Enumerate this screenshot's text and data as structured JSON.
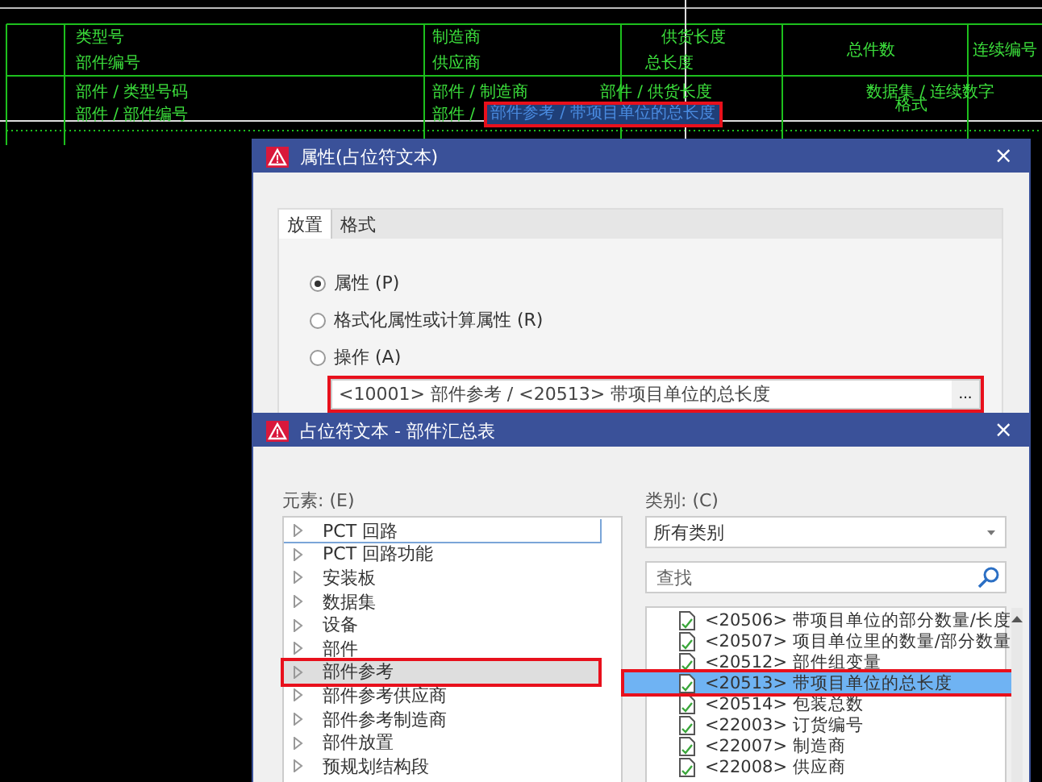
{
  "drawing": {
    "header": [
      {
        "text": "类型号"
      },
      {
        "text": "部件编号"
      },
      {
        "text": "制造商"
      },
      {
        "text": "供应商"
      },
      {
        "text": "供货长度"
      },
      {
        "text": "总长度"
      },
      {
        "text": "总件数"
      },
      {
        "text": "连续编号"
      }
    ],
    "fields": [
      {
        "text": "部件 / 类型号码",
        "selected": false
      },
      {
        "text": "部件 / 部件编号",
        "selected": false
      },
      {
        "text": "部件 / 制造商",
        "selected": false
      },
      {
        "text": "部件 /",
        "selected": false
      },
      {
        "text": "部件 / 供货长度",
        "selected": false
      },
      {
        "text": "部件参考 / 带项目单位的总长度",
        "selected": true
      },
      {
        "text": "数据集 / 连续数字",
        "selected": false
      },
      {
        "text": "格式",
        "selected": false
      }
    ]
  },
  "properties_dialog": {
    "title": "属性(占位符文本)",
    "close": "×",
    "tabs": [
      {
        "label": "放置",
        "selected": true
      },
      {
        "label": "格式",
        "selected": false
      }
    ],
    "options": [
      {
        "label": "属性 (P)",
        "selected": true
      },
      {
        "label": "格式化属性或计算属性 (R)",
        "selected": false
      },
      {
        "label": "操作 (A)",
        "selected": false
      }
    ],
    "value": "<10001> 部件参考 / <20513> 带项目单位的总长度",
    "value_annotated": true,
    "browse": "..."
  },
  "placeholder_dialog": {
    "title": "占位符文本 - 部件汇总表",
    "close": "×",
    "elements_label": "元素: (E)",
    "elements": [
      {
        "label": "PCT 回路",
        "selected": false,
        "focused": true,
        "annotated": false
      },
      {
        "label": "PCT 回路功能",
        "selected": false,
        "focused": false,
        "annotated": false
      },
      {
        "label": "安装板",
        "selected": false,
        "focused": false,
        "annotated": false
      },
      {
        "label": "数据集",
        "selected": false,
        "focused": false,
        "annotated": false
      },
      {
        "label": "设备",
        "selected": false,
        "focused": false,
        "annotated": false
      },
      {
        "label": "部件",
        "selected": false,
        "focused": false,
        "annotated": false
      },
      {
        "label": "部件参考",
        "selected": true,
        "focused": false,
        "annotated": true
      },
      {
        "label": "部件参考供应商",
        "selected": false,
        "focused": false,
        "annotated": false
      },
      {
        "label": "部件参考制造商",
        "selected": false,
        "focused": false,
        "annotated": false
      },
      {
        "label": "部件放置",
        "selected": false,
        "focused": false,
        "annotated": false
      },
      {
        "label": "预规划结构段",
        "selected": false,
        "focused": false,
        "annotated": false
      }
    ],
    "categories_label": "类别: (C)",
    "category": "所有类别",
    "search": {
      "placeholder": "查找"
    },
    "properties": [
      {
        "label": "<20506> 带项目单位的部分数量/长度",
        "selected": false,
        "annotated": false
      },
      {
        "label": "<20507> 项目单位里的数量/部分数量",
        "selected": false,
        "annotated": false
      },
      {
        "label": "<20512> 部件组变量",
        "selected": false,
        "annotated": false
      },
      {
        "label": "<20513> 带项目单位的总长度",
        "selected": true,
        "annotated": true
      },
      {
        "label": "<20514> 包装总数",
        "selected": false,
        "annotated": false
      },
      {
        "label": "<22003> 订货编号",
        "selected": false,
        "annotated": false
      },
      {
        "label": "<22007> 制造商",
        "selected": false,
        "annotated": false
      },
      {
        "label": "<22008> 供应商",
        "selected": false,
        "annotated": false
      }
    ]
  }
}
